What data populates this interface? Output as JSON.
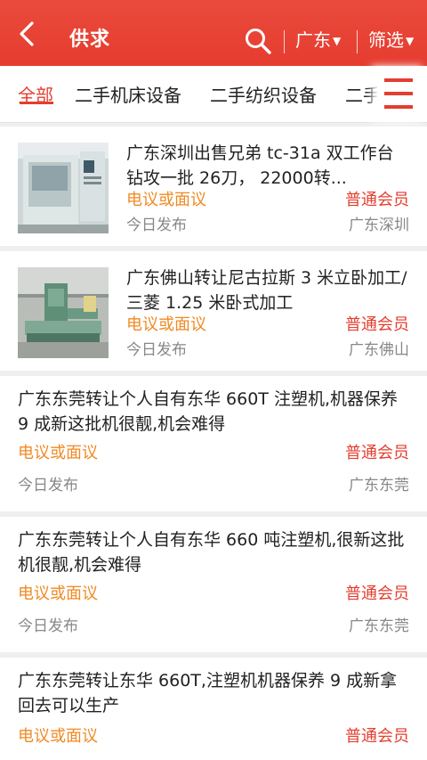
{
  "header": {
    "title": "供求",
    "region_label": "广东",
    "filter_label": "筛选",
    "back_icon": "back-arrow-icon",
    "search_icon": "search-icon",
    "background": "#e53d2f"
  },
  "tabs": [
    {
      "label": "全部",
      "active": true
    },
    {
      "label": "二手机床设备",
      "active": false
    },
    {
      "label": "二手纺织设备",
      "active": false
    },
    {
      "label": "二手",
      "active": false
    }
  ],
  "menu_icon": "hamburger-menu-icon",
  "listings": [
    {
      "title": "广东深圳出售兄弟 tc-31a 双工作台钻攻一批 26刀， 22000转...",
      "price": "电议或面议",
      "member": "普通会员",
      "date": "今日发布",
      "location": "广东深圳",
      "has_image": true,
      "image": "machine-center-photo"
    },
    {
      "title": "广东佛山转让尼古拉斯 3 米立卧加工/三菱 1.25 米卧式加工",
      "price": "电议或面议",
      "member": "普通会员",
      "date": "今日发布",
      "location": "广东佛山",
      "has_image": true,
      "image": "milling-machine-photo"
    },
    {
      "title": "广东东莞转让个人自有东华 660T 注塑机,机器保养 9 成新这批机很靓,机会难得",
      "price": "电议或面议",
      "member": "普通会员",
      "date": "今日发布",
      "location": "广东东莞",
      "has_image": false
    },
    {
      "title": "广东东莞转让个人自有东华 660 吨注塑机,很新这批机很靓,机会难得",
      "price": "电议或面议",
      "member": "普通会员",
      "date": "今日发布",
      "location": "广东东莞",
      "has_image": false
    },
    {
      "title": "广东东莞转让东华 660T,注塑机机器保养 9 成新拿回去可以生产",
      "price": "电议或面议",
      "member": "普通会员",
      "has_image": false
    }
  ],
  "colors": {
    "accent": "#e53d2f",
    "price": "#f08a24",
    "muted": "#888888"
  }
}
